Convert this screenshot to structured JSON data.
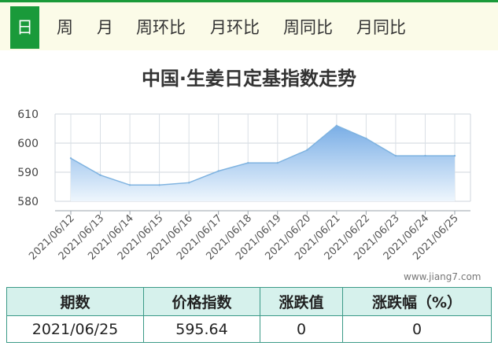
{
  "tabs": [
    {
      "label": "日",
      "active": true
    },
    {
      "label": "周",
      "active": false
    },
    {
      "label": "月",
      "active": false
    },
    {
      "label": "周环比",
      "active": false
    },
    {
      "label": "月环比",
      "active": false
    },
    {
      "label": "周同比",
      "active": false
    },
    {
      "label": "月同比",
      "active": false
    }
  ],
  "watermark": "www.jiang7.com",
  "table": {
    "headers": [
      "期数",
      "价格指数",
      "涨跌值",
      "涨跌幅（%）"
    ],
    "row": [
      "2021/06/25",
      "595.64",
      "0",
      "0"
    ]
  },
  "colors": {
    "accent": "#1a9a3a",
    "line": "#7fb3e0",
    "area_top": "#7aaee6",
    "area_bottom": "#eef6fd"
  },
  "chart_data": {
    "type": "area",
    "title": "中国·生姜日定基指数走势",
    "categories": [
      "2021/06/12",
      "2021/06/13",
      "2021/06/14",
      "2021/06/15",
      "2021/06/16",
      "2021/06/17",
      "2021/06/18",
      "2021/06/19",
      "2021/06/20",
      "2021/06/21",
      "2021/06/22",
      "2021/06/23",
      "2021/06/24",
      "2021/06/25"
    ],
    "values": [
      594.8,
      589.0,
      585.6,
      585.6,
      586.4,
      590.4,
      593.2,
      593.2,
      597.6,
      606.0,
      601.6,
      595.64,
      595.64,
      595.64
    ],
    "ylim": [
      580,
      610
    ],
    "yticks": [
      580,
      590,
      600,
      610
    ],
    "xlabel": "",
    "ylabel": "",
    "grid": true,
    "legend": "none"
  }
}
